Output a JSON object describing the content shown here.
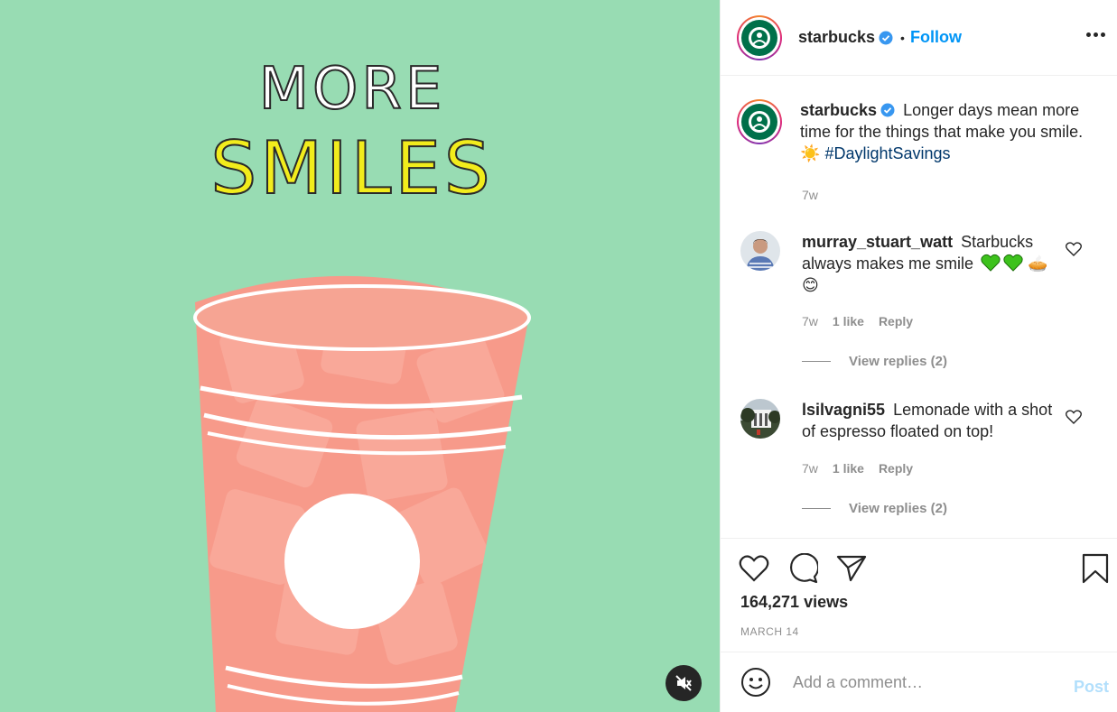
{
  "media": {
    "headline_line1": "MORE",
    "headline_line2": "SMILES",
    "mute_icon": "speaker-muted-icon"
  },
  "post_header": {
    "username": "starbucks",
    "verified": true,
    "separator": "•",
    "follow_label": "Follow",
    "more_icon": "more-options-icon"
  },
  "caption": {
    "username": "starbucks",
    "text": "Longer days mean more time for the things that make you smile. ☀️",
    "hashtag": "#DaylightSavings",
    "time": "7w"
  },
  "comments": [
    {
      "username": "murray_stuart_watt",
      "text": "Starbucks always makes me smile",
      "emojis_after": "🥧😊",
      "time": "7w",
      "likes": "1 like",
      "reply_label": "Reply",
      "view_replies": "View replies (2)"
    },
    {
      "username": "lsilvagni55",
      "text": "Lemonade with a shot of espresso floated on top!",
      "time": "7w",
      "likes": "1 like",
      "reply_label": "Reply",
      "view_replies": "View replies (2)"
    }
  ],
  "actions": {
    "views": "164,271 views",
    "date": "MARCH 14"
  },
  "add_comment": {
    "placeholder": "Add a comment…",
    "post_label": "Post"
  },
  "colors": {
    "media_bg": "#98dcb3",
    "cup": "#f79a8a",
    "accent_blue": "#0095f6",
    "hashtag": "#00376b",
    "headline_yellow": "#f2ec1c"
  }
}
